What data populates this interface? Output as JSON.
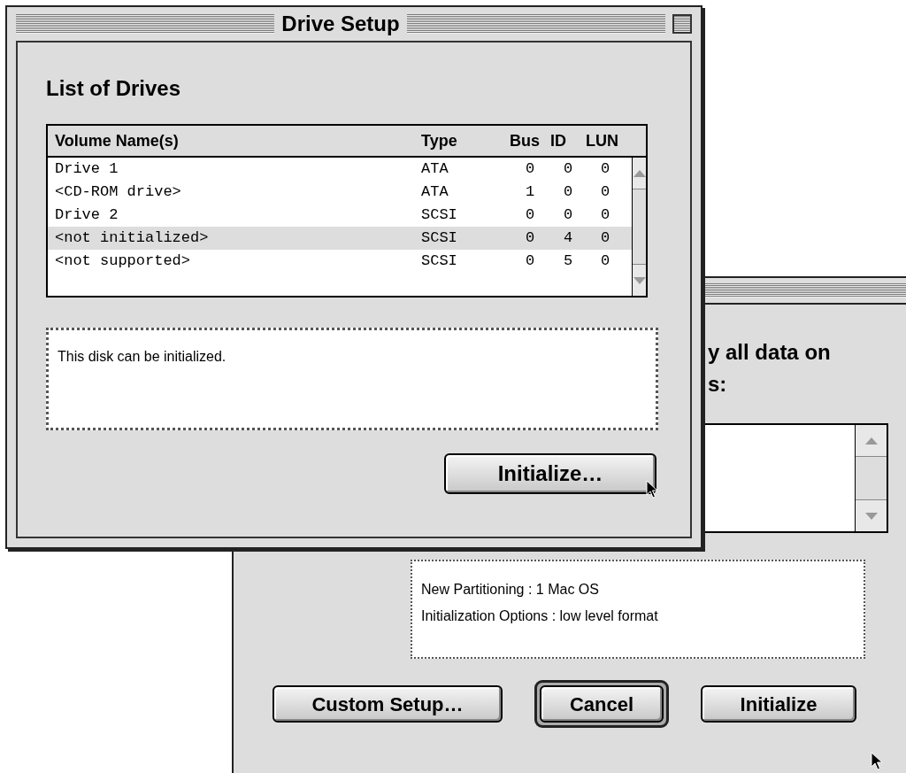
{
  "front_window": {
    "title": "Drive Setup",
    "heading": "List of Drives",
    "table": {
      "columns": [
        "Volume Name(s)",
        "Type",
        "Bus",
        "ID",
        "LUN"
      ],
      "rows": [
        {
          "cells": [
            "Drive 1",
            "ATA",
            "0",
            "0",
            "0"
          ],
          "selected": false
        },
        {
          "cells": [
            "<CD-ROM drive>",
            "ATA",
            "1",
            "0",
            "0"
          ],
          "selected": false
        },
        {
          "cells": [
            "Drive 2",
            "SCSI",
            "0",
            "0",
            "0"
          ],
          "selected": false
        },
        {
          "cells": [
            "<not initialized>",
            "SCSI",
            "0",
            "4",
            "0"
          ],
          "selected": true
        },
        {
          "cells": [
            "<not supported>",
            "SCSI",
            "0",
            "5",
            "0"
          ],
          "selected": false
        }
      ]
    },
    "description": "This disk can be initialized.",
    "button": "Initialize…"
  },
  "back_window": {
    "heading_lines": [
      "y all data on",
      "s:"
    ],
    "summary": [
      "New Partitioning : 1 Mac OS",
      "Initialization Options : low level format"
    ],
    "buttons": [
      {
        "label": "Custom Setup…",
        "default": false
      },
      {
        "label": "Cancel",
        "default": true
      },
      {
        "label": "Initialize",
        "default": false
      }
    ]
  }
}
